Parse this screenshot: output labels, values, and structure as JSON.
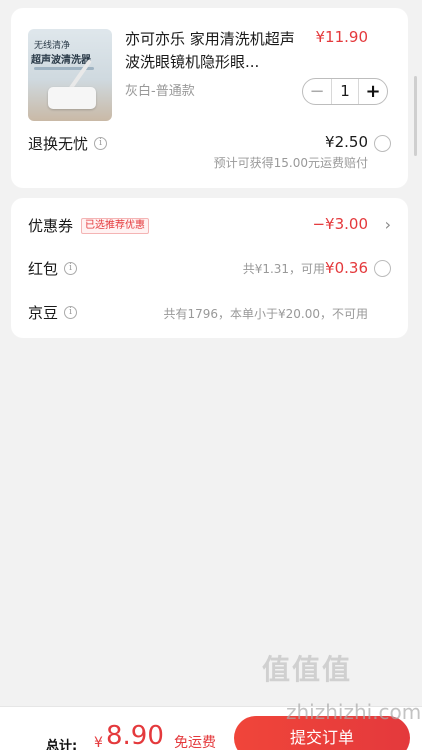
{
  "product": {
    "thumb_line1": "无线清净",
    "thumb_line2": "超声波清洗器",
    "title": "亦可亦乐 家用清洗机超声波洗眼镜机隐形眼...",
    "price": "¥11.90",
    "spec": "灰白-普通款",
    "quantity": "1",
    "minus": "−",
    "plus": "+"
  },
  "return_service": {
    "label": "退换无忧",
    "price": "¥2.50",
    "note": "预计可获得15.00元运费赔付"
  },
  "coupon": {
    "label": "优惠券",
    "tag": "已选推荐优惠",
    "amount": "−¥3.00"
  },
  "red_packet": {
    "label": "红包",
    "note": "共¥1.31，可用",
    "available": "¥0.36"
  },
  "jingdou": {
    "label": "京豆",
    "note": "共有1796，本单小于¥20.00，不可用"
  },
  "footer": {
    "total_label": "总计:",
    "currency": "¥",
    "total": "8.90",
    "shipping": "免运费",
    "submit": "提交订单"
  },
  "watermark": {
    "logo": "值值值",
    "site": "zhizhizhi.com"
  },
  "colors": {
    "accent": "#e4393c",
    "background": "#f2f2f2"
  }
}
